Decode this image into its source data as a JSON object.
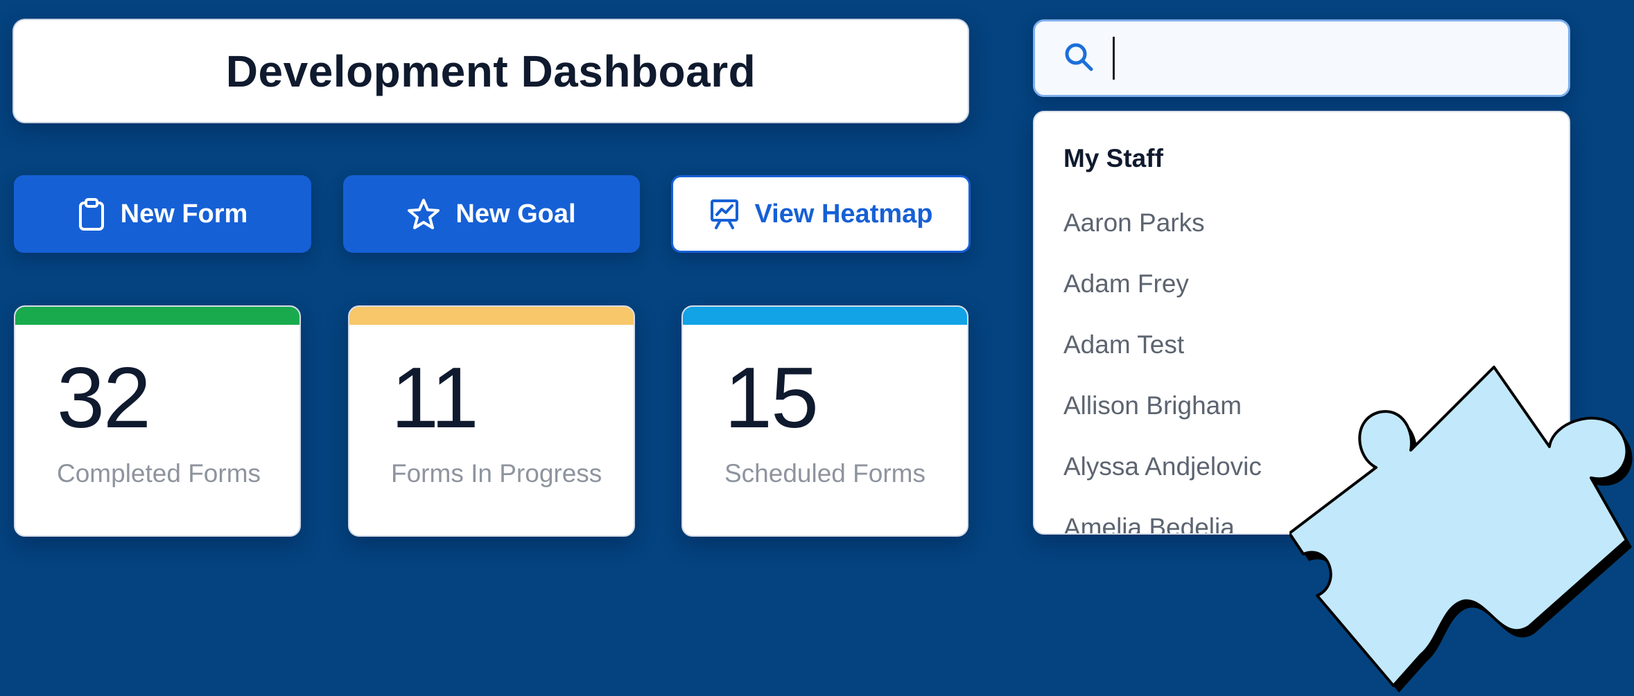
{
  "header": {
    "title": "Development Dashboard"
  },
  "actions": [
    {
      "label": "New Form",
      "icon": "clipboard-icon",
      "style": "primary"
    },
    {
      "label": "New Goal",
      "icon": "star-icon",
      "style": "primary"
    },
    {
      "label": "View Heatmap",
      "icon": "presentation-chart-icon",
      "style": "secondary"
    }
  ],
  "stats": [
    {
      "value": "32",
      "label": "Completed Forms",
      "color": "#1aaa4e"
    },
    {
      "value": "11",
      "label": "Forms In Progress",
      "color": "#f8c76a"
    },
    {
      "value": "15",
      "label": "Scheduled Forms",
      "color": "#11a3e6"
    }
  ],
  "search": {
    "value": "",
    "placeholder": "",
    "icon": "search-icon"
  },
  "staff_list": {
    "header": "My Staff",
    "items": [
      "Aaron Parks",
      "Adam Frey",
      "Adam Test",
      "Allison Brigham",
      "Alyssa Andjelovic",
      "Amelia Bedelia"
    ]
  },
  "colors": {
    "background": "#04437f",
    "primary": "#1660d6",
    "puzzle_fill": "#c2e8fb"
  },
  "decoration": {
    "icon": "puzzle-piece-icon"
  }
}
